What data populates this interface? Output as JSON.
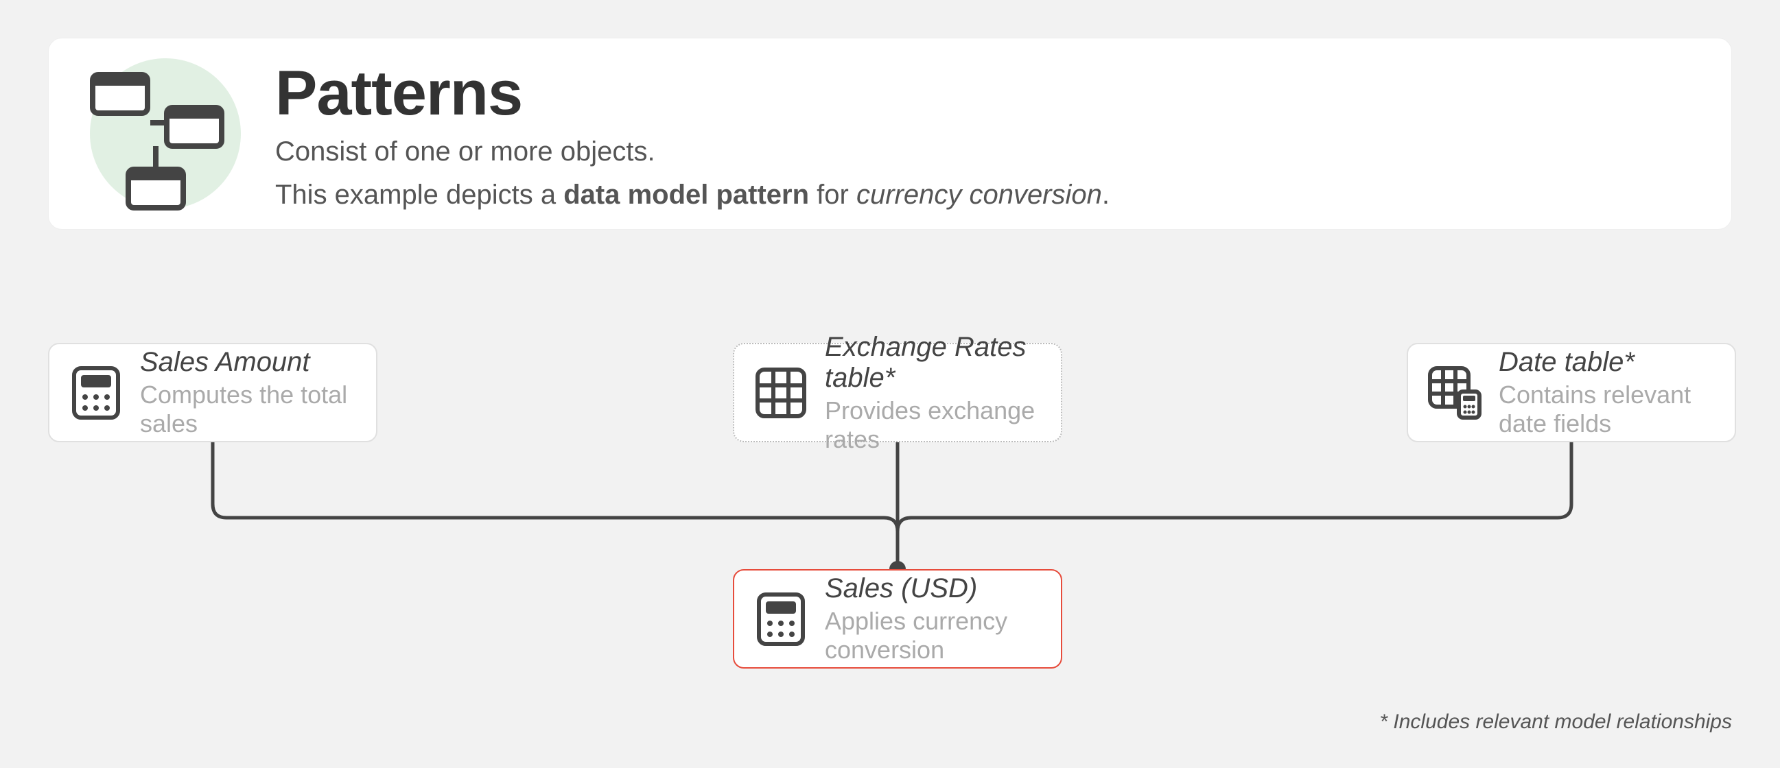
{
  "header": {
    "title": "Patterns",
    "subtitle1": "Consist of one or more objects.",
    "subtitle2_pre": "This example depicts a ",
    "subtitle2_bold": "data model pattern",
    "subtitle2_mid": " for ",
    "subtitle2_italic": "currency conversion",
    "subtitle2_post": "."
  },
  "nodes": {
    "sales_amount": {
      "title": "Sales Amount",
      "desc": "Computes the total sales"
    },
    "exchange_rates": {
      "title": "Exchange Rates table*",
      "desc": "Provides exchange rates"
    },
    "date_table": {
      "title": "Date table*",
      "desc": "Contains relevant date fields"
    },
    "sales_usd": {
      "title": "Sales (USD)",
      "desc": "Applies currency conversion"
    }
  },
  "footnote": "* Includes relevant model relationships"
}
